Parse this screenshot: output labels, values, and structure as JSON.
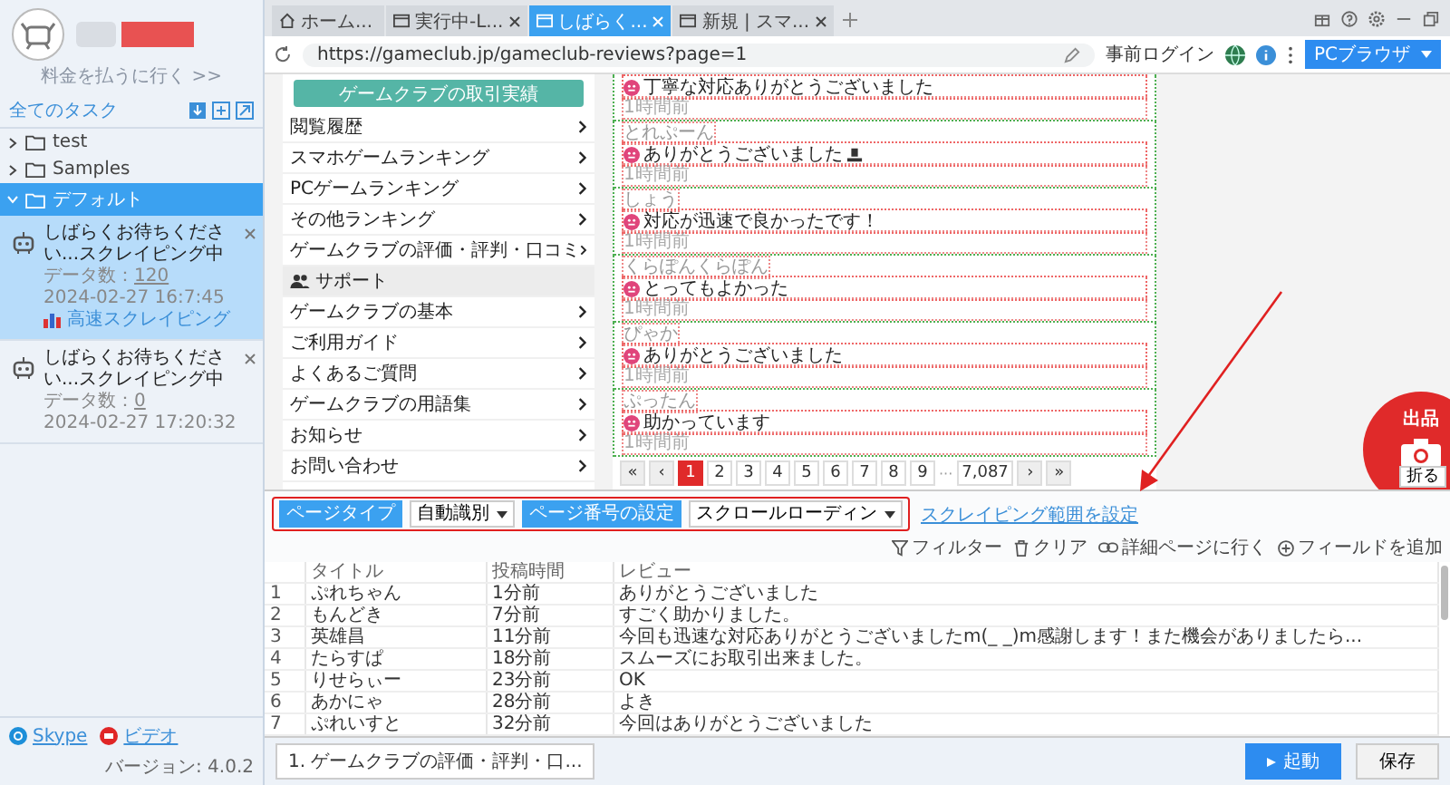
{
  "sidebar": {
    "pay_link": "料金を払うに行く >>",
    "all_tasks": "全てのタスク",
    "folders": [
      {
        "name": "test",
        "expanded": false,
        "selected": false
      },
      {
        "name": "Samples",
        "expanded": false,
        "selected": false
      },
      {
        "name": "デフォルト",
        "expanded": true,
        "selected": true,
        "tasks": [
          {
            "title": "しばらくお待ちください...スクレイピング中",
            "data_label": "データ数：",
            "count": "120",
            "date": "2024-02-27 16:7:45",
            "mode": "高速スクレイピング",
            "selected": true
          },
          {
            "title": "しばらくお待ちください...スクレイピング中",
            "data_label": "データ数：",
            "count": "0",
            "date": "2024-02-27 17:20:32",
            "selected": false
          }
        ]
      }
    ],
    "footer": {
      "skype": "Skype",
      "video": "ビデオ",
      "version": "バージョン: 4.0.2"
    }
  },
  "browser": {
    "tabs": [
      {
        "label": "ホーム...",
        "kind": "home",
        "closable": false,
        "selected": false
      },
      {
        "label": "実行中-L...",
        "kind": "page",
        "closable": true,
        "selected": false
      },
      {
        "label": "しばらく...",
        "kind": "page",
        "closable": true,
        "selected": true
      },
      {
        "label": "新規 | スマ...",
        "kind": "page",
        "closable": true,
        "selected": false
      }
    ],
    "url": "https://gameclub.jp/gameclub-reviews?page=1",
    "pre_login": "事前ログイン",
    "mode_button": "PCブラウザ"
  },
  "page": {
    "menu_button": "ゲームクラブの取引実績",
    "menu": [
      {
        "label": "閲覧履歴",
        "kind": "link"
      },
      {
        "label": "スマホゲームランキング",
        "kind": "link"
      },
      {
        "label": "PCゲームランキング",
        "kind": "link"
      },
      {
        "label": "その他ランキング",
        "kind": "link"
      },
      {
        "label": "ゲームクラブの評価・評判・口コミ",
        "kind": "link"
      },
      {
        "label": "サポート",
        "kind": "heading"
      },
      {
        "label": "ゲームクラブの基本",
        "kind": "link"
      },
      {
        "label": "ご利用ガイド",
        "kind": "link"
      },
      {
        "label": "よくあるご質問",
        "kind": "link"
      },
      {
        "label": "ゲームクラブの用語集",
        "kind": "link"
      },
      {
        "label": "お知らせ",
        "kind": "link"
      },
      {
        "label": "お問い合わせ",
        "kind": "link"
      }
    ],
    "reviews": [
      {
        "comment": "丁寧な対応ありがとうございました",
        "time": "1時間前",
        "trailing_icon": false
      },
      {
        "name": "とれぷーん",
        "comment": "ありがとうございました",
        "time": "1時間前",
        "trailing_icon": true
      },
      {
        "name": "しょう",
        "comment": "対応が迅速で良かったです！",
        "time": "1時間前",
        "trailing_icon": false
      },
      {
        "name": "くらぽんくらぽん",
        "comment": "とってもよかった",
        "time": "1時間前",
        "trailing_icon": false
      },
      {
        "name": "ぴゃか",
        "comment": "ありがとうございました",
        "time": "1時間前",
        "trailing_icon": false
      },
      {
        "name": "ぷったん",
        "comment": "助かっています",
        "time": "1時間前",
        "trailing_icon": false
      }
    ],
    "pagination": [
      {
        "label": "«",
        "kind": "nav",
        "selected": false
      },
      {
        "label": "‹",
        "kind": "nav",
        "selected": false
      },
      {
        "label": "1",
        "kind": "page",
        "selected": true
      },
      {
        "label": "2",
        "kind": "page",
        "selected": false
      },
      {
        "label": "3",
        "kind": "page",
        "selected": false
      },
      {
        "label": "4",
        "kind": "page",
        "selected": false
      },
      {
        "label": "5",
        "kind": "page",
        "selected": false
      },
      {
        "label": "6",
        "kind": "page",
        "selected": false
      },
      {
        "label": "7",
        "kind": "page",
        "selected": false
      },
      {
        "label": "8",
        "kind": "page",
        "selected": false
      },
      {
        "label": "9",
        "kind": "page",
        "selected": false
      },
      {
        "label": "···",
        "kind": "gap"
      },
      {
        "label": "7,087",
        "kind": "page",
        "selected": false
      },
      {
        "label": "›",
        "kind": "nav",
        "selected": false
      },
      {
        "label": "»",
        "kind": "nav",
        "selected": false
      }
    ],
    "fab": "出品",
    "collapse": "折る"
  },
  "toolbar": {
    "page_type_label": "ページタイプ",
    "page_type": "自動識別",
    "page_number_label": "ページ番号の設定",
    "page_number": "スクロールローディン",
    "range_link": "スクレイピング範囲を設定",
    "actions": [
      {
        "label": "フィルター",
        "kind": "filter"
      },
      {
        "label": "クリア",
        "kind": "trash"
      },
      {
        "label": "詳細ページに行く",
        "kind": "link"
      },
      {
        "label": "フィールドを追加",
        "kind": "add"
      }
    ]
  },
  "table": {
    "columns": [
      "",
      "タイトル",
      "投稿時間",
      "レビュー"
    ],
    "rows": [
      [
        "1",
        "ぷれちゃん",
        "1分前",
        "ありがとうございました"
      ],
      [
        "2",
        "もんどき",
        "7分前",
        "すごく助かりました。"
      ],
      [
        "3",
        "英雄昌",
        "11分前",
        "今回も迅速な対応ありがとうございましたm(_ _)m感謝します！また機会がありましたら..."
      ],
      [
        "4",
        "たらすぱ",
        "18分前",
        "スムーズにお取引出来ました。"
      ],
      [
        "5",
        "りせらぃー",
        "23分前",
        "OK"
      ],
      [
        "6",
        "あかにゃ",
        "28分前",
        "よき"
      ],
      [
        "7",
        "ぷれいすと",
        "32分前",
        "今回はありがとうございました"
      ]
    ]
  },
  "footer": {
    "task_tab": "1. ゲームクラブの評価・評判・口...",
    "start": "起動",
    "save": "保存"
  }
}
